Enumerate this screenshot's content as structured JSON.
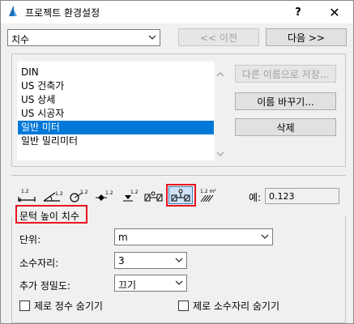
{
  "window": {
    "title": "프로젝트 환경설정",
    "help_label": "?",
    "close_label": "✕"
  },
  "top": {
    "category_value": "치수",
    "prev_label": "<< 이전",
    "next_label": "다음 >>"
  },
  "presets": {
    "items": [
      "DIN",
      "US 건축가",
      "US 상세",
      "US 시공자",
      "일반 미터",
      "일반 밀리미터"
    ],
    "selected_index": 4,
    "save_as_label": "다른 이름으로 저장...",
    "rename_label": "이름 바꾸기...",
    "delete_label": "삭제"
  },
  "toolbar": {
    "icons": [
      "linear-dimension-icon",
      "angle-dimension-icon",
      "radial-dimension-icon",
      "level-dimension-icon",
      "elevation-dimension-icon",
      "door-window-dimension-icon",
      "sill-height-dimension-icon",
      "area-dimension-icon"
    ],
    "active_index": 6,
    "example_label": "예:",
    "example_value": "0.123"
  },
  "section": {
    "title": "문턱 높이 치수",
    "unit_label": "단위:",
    "unit_value": "m",
    "decimals_label": "소수자리:",
    "decimals_value": "3",
    "precision_label": "추가 정밀도:",
    "precision_value": "끄기",
    "hide_zero_whole_label": "제로 정수 숨기기",
    "hide_zero_whole_checked": false,
    "hide_zero_decimal_label": "제로 소수자리 숨기기",
    "hide_zero_decimal_checked": false
  }
}
